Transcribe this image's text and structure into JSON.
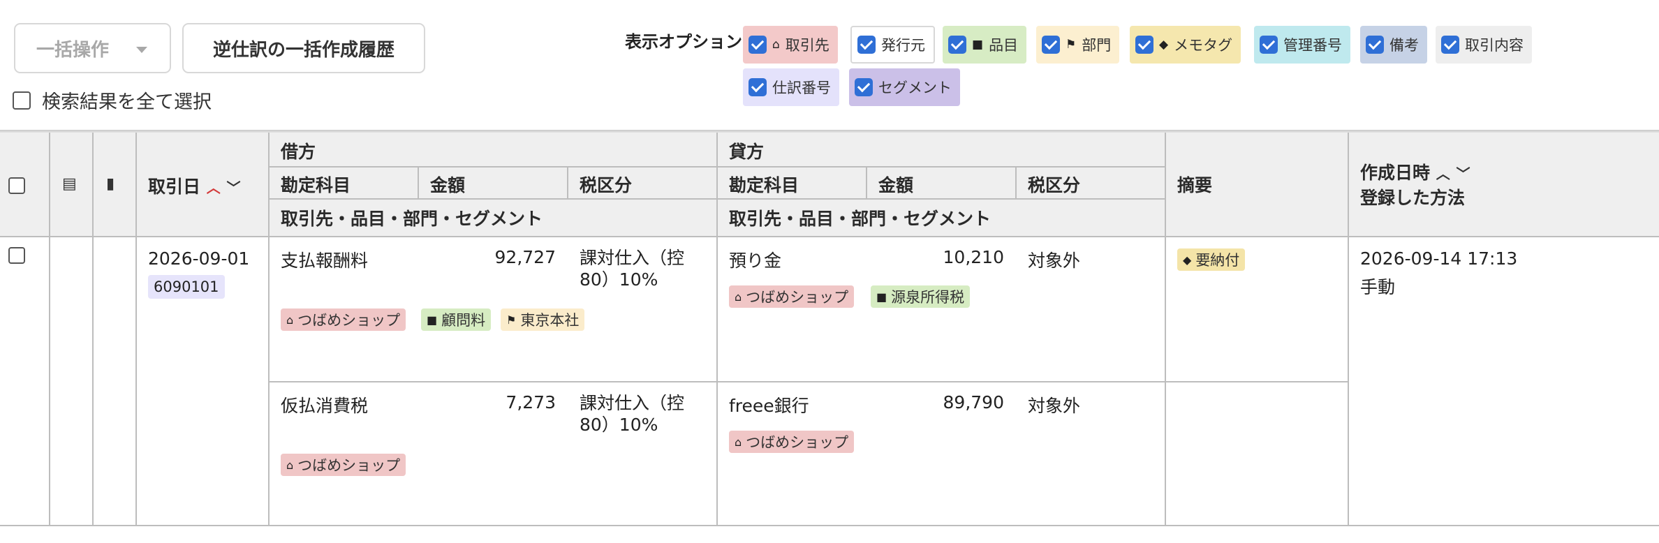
{
  "toolbar": {
    "bulk_label": "一括操作",
    "history_label": "逆仕訳の一括作成履歴",
    "select_all_label": "検索結果を全て選択"
  },
  "display_options": {
    "title": "表示オプション",
    "options": [
      {
        "label": "取引先",
        "icon": "home-icon",
        "color": "#f3c9c9",
        "checked": true
      },
      {
        "label": "発行元",
        "icon": "",
        "color": "#ffffff",
        "checked": true
      },
      {
        "label": "品目",
        "icon": "briefcase-icon",
        "color": "#d7ecc4",
        "checked": true
      },
      {
        "label": "部門",
        "icon": "flag-icon",
        "color": "#fcefd0",
        "checked": true
      },
      {
        "label": "メモタグ",
        "icon": "tag-icon",
        "color": "#f5e7ae",
        "checked": true
      },
      {
        "label": "管理番号",
        "icon": "",
        "color": "#bfe9ee",
        "checked": true
      },
      {
        "label": "備考",
        "icon": "",
        "color": "#c6d2e6",
        "checked": true
      },
      {
        "label": "取引内容",
        "icon": "",
        "color": "#eeeeee",
        "checked": true
      },
      {
        "label": "仕訳番号",
        "icon": "",
        "color": "#e4e2fb",
        "checked": true
      },
      {
        "label": "セグメント",
        "icon": "",
        "color": "#cbc0e8",
        "checked": true
      }
    ]
  },
  "table": {
    "headers": {
      "date": "取引日",
      "debit": "借方",
      "credit": "貸方",
      "account": "勘定科目",
      "amount": "金額",
      "tax": "税区分",
      "meta": "取引先・品目・部門・セグメント",
      "summary": "摘要",
      "created_at": "作成日時",
      "method": "登録した方法"
    },
    "row": {
      "date": "2026-09-01",
      "journal_no": "6090101",
      "summary_tag": "要納付",
      "created_at": "2026-09-14 17:13",
      "method": "手動",
      "lines": [
        {
          "debit": {
            "account": "支払報酬料",
            "amount": "92,727",
            "tax": "課対仕入（控80）10%",
            "tags": [
              {
                "label": "つばめショップ",
                "type": "partner"
              },
              {
                "label": "顧問料",
                "type": "item"
              },
              {
                "label": "東京本社",
                "type": "dept"
              }
            ]
          },
          "credit": {
            "account": "預り金",
            "amount": "10,210",
            "tax": "対象外",
            "tags": [
              {
                "label": "つばめショップ",
                "type": "partner"
              },
              {
                "label": "源泉所得税",
                "type": "item"
              }
            ]
          }
        },
        {
          "debit": {
            "account": "仮払消費税",
            "amount": "7,273",
            "tax": "課対仕入（控80）10%",
            "tags": [
              {
                "label": "つばめショップ",
                "type": "partner"
              }
            ]
          },
          "credit": {
            "account": "freee銀行",
            "amount": "89,790",
            "tax": "対象外",
            "tags": [
              {
                "label": "つばめショップ",
                "type": "partner"
              }
            ]
          }
        }
      ]
    }
  }
}
